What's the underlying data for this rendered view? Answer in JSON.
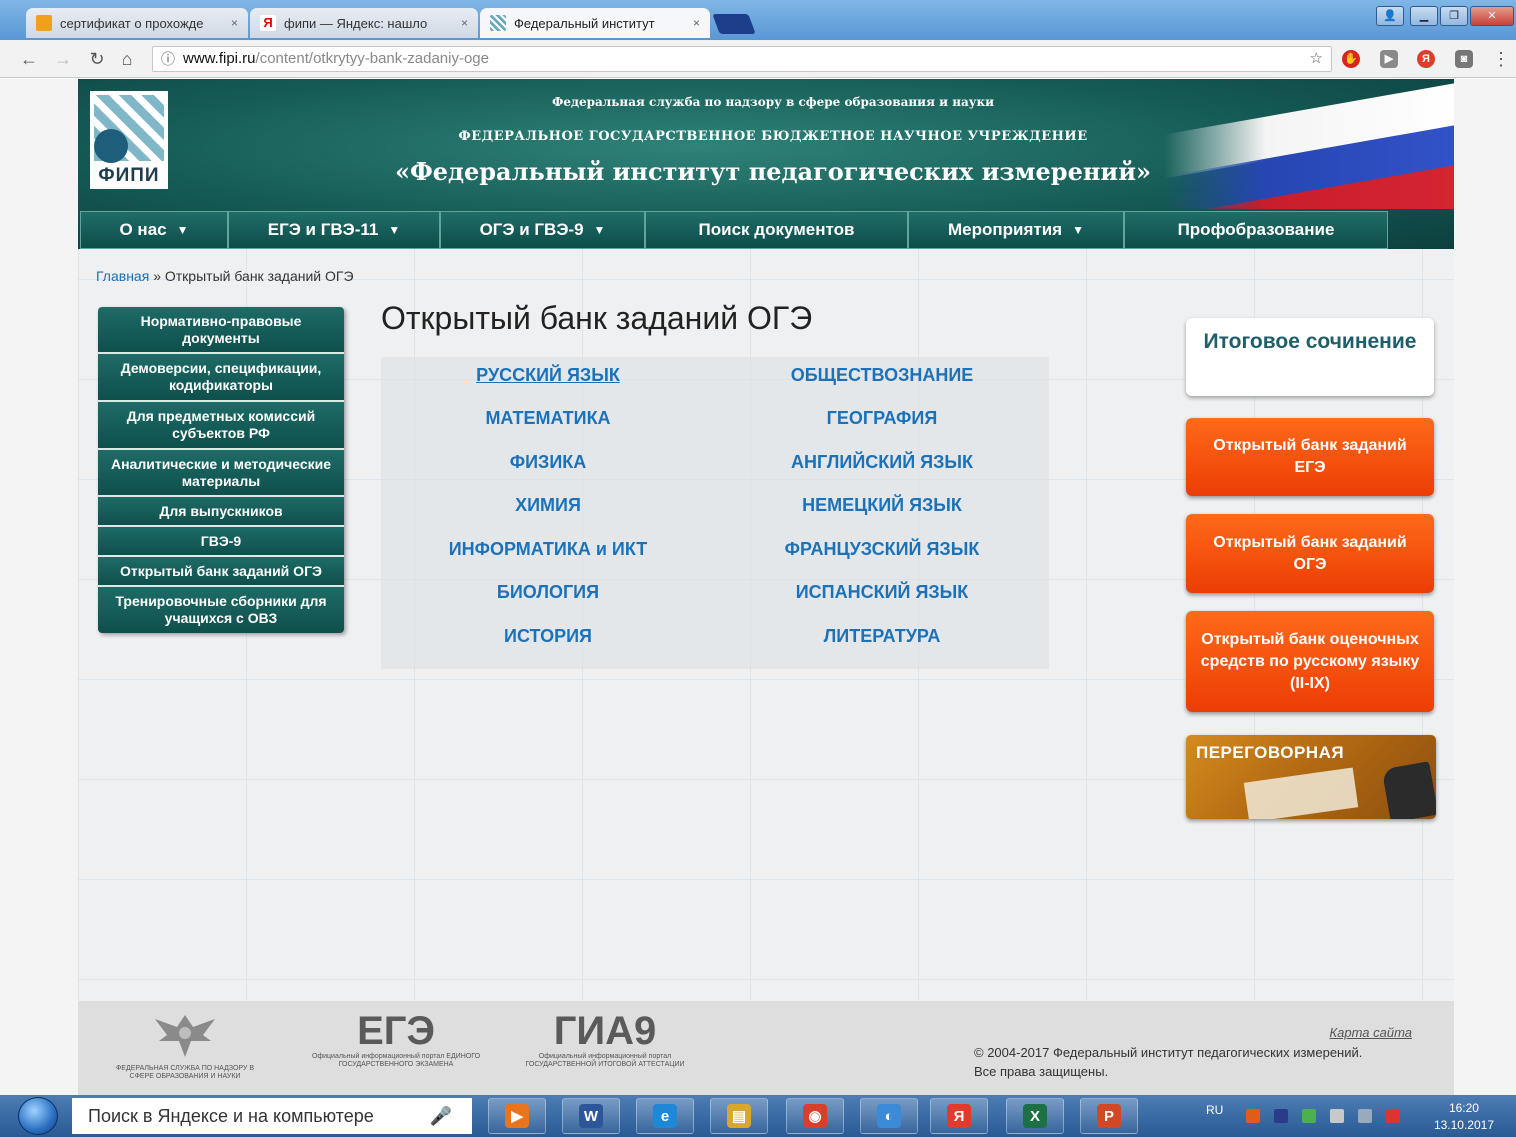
{
  "browser": {
    "tabs": [
      {
        "label": "сертификат о прохожде",
        "close": "×"
      },
      {
        "label": "фипи — Яндекс: нашло",
        "close": "×"
      },
      {
        "label": "Федеральный институт",
        "close": "×"
      }
    ],
    "url_host": "www.fipi.ru",
    "url_path": "/content/otkrytyy-bank-zadaniy-oge",
    "nav_icons": [
      "back-arrow-icon",
      "forward-arrow-icon",
      "reload-icon",
      "home-icon",
      "info-icon",
      "star-icon"
    ],
    "window_controls": [
      "▁",
      "❐",
      "✕"
    ]
  },
  "header": {
    "logo_text": "ФИПИ",
    "line1": "Федеральная служба по надзору в сфере образования и науки",
    "line2": "ФЕДЕРАЛЬНОЕ ГОСУДАРСТВЕННОЕ БЮДЖЕТНОЕ НАУЧНОЕ УЧРЕЖДЕНИЕ",
    "line3": "«Федеральный институт педагогических измерений»",
    "flag_colors": [
      "#ffffff",
      "#2746b3",
      "#c81e2b"
    ]
  },
  "nav": [
    {
      "label": "О нас",
      "arrow": "▼"
    },
    {
      "label": "ЕГЭ и ГВЭ-11",
      "arrow": "▼"
    },
    {
      "label": "ОГЭ и ГВЭ-9",
      "arrow": "▼"
    },
    {
      "label": "Поиск документов",
      "arrow": ""
    },
    {
      "label": "Мероприятия",
      "arrow": "▼"
    },
    {
      "label": "Профобразование",
      "arrow": ""
    }
  ],
  "breadcrumb": {
    "home": "Главная",
    "separator": "»",
    "current": "Открытый банк заданий ОГЭ"
  },
  "sidebar": [
    "Нормативно-правовые документы",
    "Демоверсии, спецификации, кодификаторы",
    "Для предметных комиссий субъектов РФ",
    "Аналитические и методические материалы",
    "Для выпускников",
    "ГВЭ-9",
    "Открытый банк заданий ОГЭ",
    "Тренировочные сборники для учащихся с ОВЗ"
  ],
  "page_title": "Открытый банк заданий ОГЭ",
  "subjects_left": [
    "РУССКИЙ ЯЗЫК",
    "МАТЕМАТИКА",
    "ФИЗИКА",
    "ХИМИЯ",
    "ИНФОРМАТИКА и ИКТ",
    "БИОЛОГИЯ",
    "ИСТОРИЯ"
  ],
  "subjects_right": [
    "ОБЩЕСТВОЗНАНИЕ",
    "ГЕОГРАФИЯ",
    "АНГЛИЙСКИЙ ЯЗЫК",
    "НЕМЕЦКИЙ ЯЗЫК",
    "ФРАНЦУЗСКИЙ ЯЗЫК",
    "ИСПАНСКИЙ ЯЗЫК",
    "ЛИТЕРАТУРА"
  ],
  "right_panel": {
    "essay": "Итоговое сочинение",
    "bank_ege": "Открытый банк заданий ЕГЭ",
    "bank_oge": "Открытый банк заданий ОГЭ",
    "bank_russian": "Открытый банк оценочных средств по русскому языку (II-IX)",
    "meeting": "ПЕРЕГОВОРНАЯ"
  },
  "footer": {
    "rosobr": "ФЕДЕРАЛЬНАЯ СЛУЖБА ПО НАДЗОРУ В СФЕРЕ ОБРАЗОВАНИЯ И НАУКИ",
    "ege_big": "ЕГЭ",
    "ege_small": "Официальный информационный портал ЕДИНОГО ГОСУДАРСТВЕННОГО ЭКЗАМЕНА",
    "gia_big": "ГИА9",
    "gia_small": "Официальный информационный портал ГОСУДАРСТВЕННОЙ ИТОГОВОЙ АТТЕСТАЦИИ",
    "sitemap": "Карта сайта",
    "copyright": "© 2004-2017 Федеральный институт педагогических измерений.",
    "rights": "Все права защищены."
  },
  "taskbar": {
    "search_text": "Поиск в Яндексе и на компьютере",
    "lang": "RU",
    "time": "16:20",
    "date": "13.10.2017",
    "apps": [
      {
        "icon": "media-player-icon",
        "glyph": "▶",
        "color": "#e8741c"
      },
      {
        "icon": "word-icon",
        "glyph": "W",
        "color": "#2b579a"
      },
      {
        "icon": "internet-explorer-icon",
        "glyph": "e",
        "color": "#1e88d6"
      },
      {
        "icon": "file-explorer-icon",
        "glyph": "▤",
        "color": "#d9a72a"
      },
      {
        "icon": "chrome-icon",
        "glyph": "◉",
        "color": "#d8402c"
      },
      {
        "icon": "sound-app-icon",
        "glyph": "◐",
        "color": "#3a8ad8"
      },
      {
        "icon": "yandex-browser-icon",
        "glyph": "Я",
        "color": "#e13b2b"
      },
      {
        "icon": "excel-icon",
        "glyph": "X",
        "color": "#1d7044"
      },
      {
        "icon": "powerpoint-icon",
        "glyph": "P",
        "color": "#d24726"
      }
    ]
  }
}
